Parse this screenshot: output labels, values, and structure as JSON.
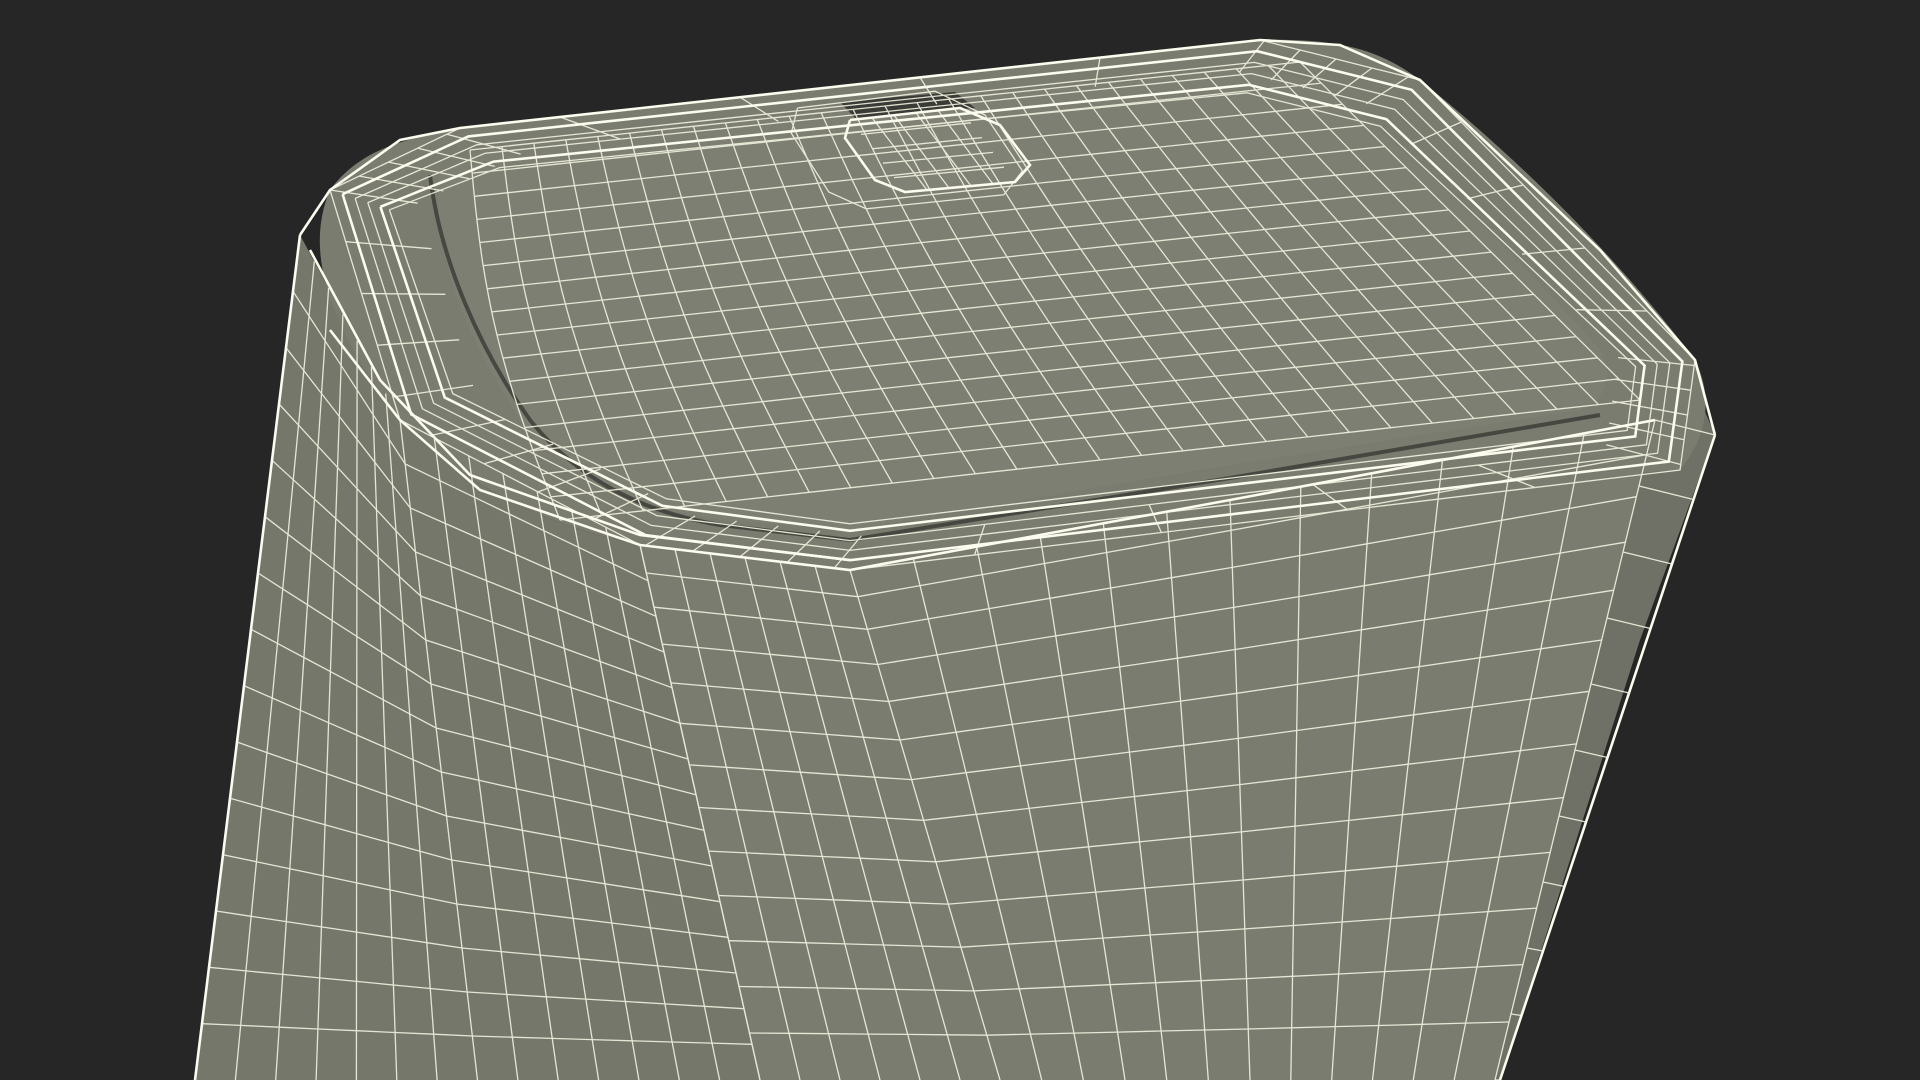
{
  "scene": {
    "subject": "wireframe-mesh-render",
    "colors": {
      "background": "#262626",
      "surface": "#7b7c70",
      "surface_shade": "#6f7066",
      "wire": "#f2f2e0",
      "crease": "#1c1c1a"
    }
  }
}
